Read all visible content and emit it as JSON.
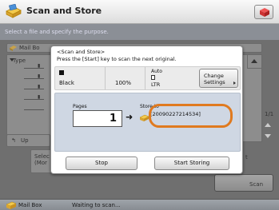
{
  "header": {
    "title": "Scan and Store",
    "logo_icon": "scanner-icon",
    "right_icon": "cube-icon"
  },
  "instruction": "Select a file and specify the purpose.",
  "background": {
    "left_item": "Mail Bo",
    "type_label": "Type",
    "up_label": "Up",
    "select_label": "Selec",
    "mem_label": "(Mor",
    "page_indicator": "1/1",
    "right_small": "t",
    "scan_label": "Scan"
  },
  "dialog": {
    "message_line1": "<Scan and Store>",
    "message_line2": "Press the [Start] key to scan the next original.",
    "color_mode": "Black",
    "zoom": "100%",
    "auto_label": "Auto",
    "paper_size": "LTR",
    "change_settings_line1": "Change",
    "change_settings_line2": "Settings",
    "pages_label": "Pages",
    "pages_value": "1",
    "store_to_label": "Store to",
    "store_to_value": "[20090227214534]",
    "stop_label": "Stop",
    "start_storing_label": "Start Storing"
  },
  "footer": {
    "location": "Mail Box",
    "status": "Waiting to scan..."
  },
  "colors": {
    "accent_orange": "#e07a1f",
    "panel_blue": "#cfd7e3"
  }
}
